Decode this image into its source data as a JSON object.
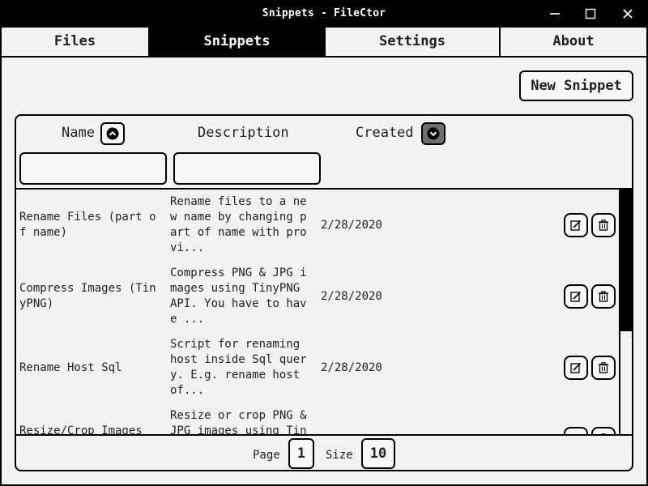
{
  "window": {
    "title": "Snippets - FileCtor"
  },
  "tabs": [
    {
      "label": "Files",
      "active": false
    },
    {
      "label": "Snippets",
      "active": true
    },
    {
      "label": "Settings",
      "active": false
    },
    {
      "label": "About",
      "active": false
    }
  ],
  "toolbar": {
    "new_snippet_label": "New Snippet"
  },
  "table": {
    "columns": {
      "name": "Name",
      "description": "Description",
      "created": "Created"
    },
    "sort": {
      "name": "ascending",
      "created": "descending"
    },
    "filters": {
      "name_value": "",
      "description_value": ""
    },
    "rows": [
      {
        "name": "Rename Files (part o\nf name)",
        "description": "Rename files to a ne\nw name by changing p\nart of name with pro\nvi...",
        "created": "2/28/2020"
      },
      {
        "name": "Compress Images (Tin\nyPNG)",
        "description": "Compress PNG & JPG i\nmages using TinyPNG\nAPI. You have to hav\ne ...",
        "created": "2/28/2020"
      },
      {
        "name": "Rename Host Sql",
        "description": "Script for renaming\nhost inside Sql quer\ny. E.g. rename host\nof...",
        "created": "2/28/2020"
      },
      {
        "name": "Resize/Crop Images",
        "description": "Resize or crop PNG &\nJPG images using Tin",
        "created": ""
      }
    ]
  },
  "pagination": {
    "page_label": "Page",
    "page_value": "1",
    "size_label": "Size",
    "size_value": "10"
  },
  "icons": {
    "row_edit": "edit-icon",
    "row_delete": "trash-icon",
    "sort_up": "chevron-up-circle-icon",
    "sort_down": "chevron-down-circle-icon"
  },
  "scroll": {
    "position_fraction": 0.0,
    "visible_fraction": 0.58
  }
}
